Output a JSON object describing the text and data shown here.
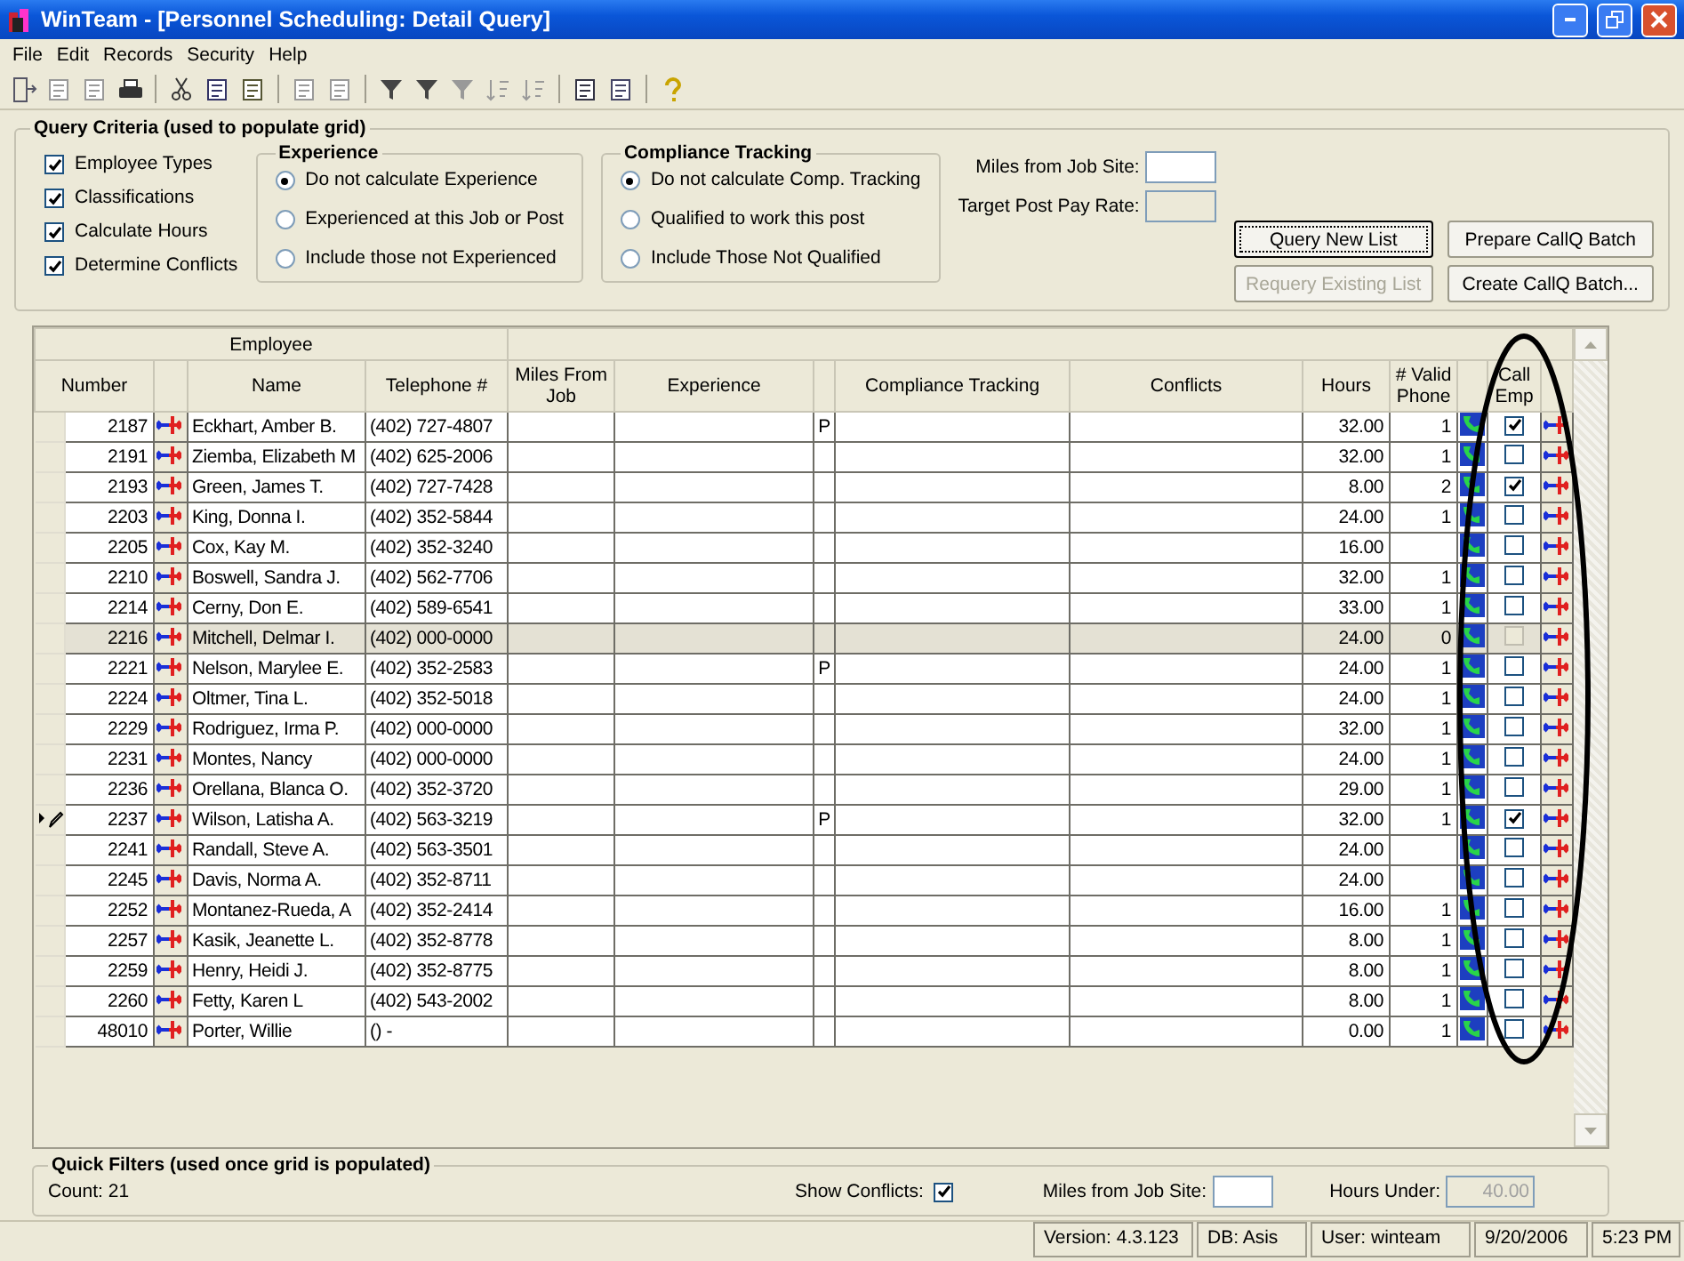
{
  "window": {
    "title": "WinTeam - [Personnel Scheduling:  Detail Query]"
  },
  "menu": [
    "File",
    "Edit",
    "Records",
    "Security",
    "Help"
  ],
  "query_criteria": {
    "title": "Query Criteria (used to populate grid)",
    "options": [
      {
        "label": "Employee Types",
        "checked": true
      },
      {
        "label": "Classifications",
        "checked": true
      },
      {
        "label": "Calculate Hours",
        "checked": true
      },
      {
        "label": "Determine Conflicts",
        "checked": true
      }
    ],
    "groups": [
      {
        "title": "Experience",
        "choices": [
          {
            "label": "Do not calculate Experience",
            "selected": true
          },
          {
            "label": "Experienced at this Job or Post",
            "selected": false
          },
          {
            "label": "Include those not Experienced",
            "selected": false
          }
        ]
      },
      {
        "title": "Compliance Tracking",
        "choices": [
          {
            "label": "Do not calculate Comp. Tracking",
            "selected": true
          },
          {
            "label": "Qualified to work this post",
            "selected": false
          },
          {
            "label": "Include Those Not Qualified",
            "selected": false
          }
        ]
      }
    ],
    "fields": [
      {
        "label": "Miles from Job Site:",
        "disabled": false
      },
      {
        "label": "Target Post Pay Rate:",
        "disabled": true
      }
    ],
    "buttons": [
      {
        "label": "Query New List",
        "disabled": false,
        "focused": true
      },
      {
        "label": "Prepare CallQ Batch",
        "disabled": false,
        "focused": false
      },
      {
        "label": "Requery Existing List",
        "disabled": true,
        "focused": false
      },
      {
        "label": "Create CallQ Batch...",
        "disabled": false,
        "focused": false
      }
    ]
  },
  "grid": {
    "group_header": "Employee",
    "columns": [
      "Number",
      "Name",
      "Telephone #",
      "Miles From Job",
      "Experience",
      "Compliance Tracking",
      "Conflicts",
      "Hours",
      "# Valid Phone",
      "Call Emp"
    ],
    "rows": [
      {
        "number": "2187",
        "name": "Eckhart, Amber B.",
        "phone": "(402) 727-4807",
        "flag": "P",
        "hours": "32.00",
        "valid": "1",
        "call": true,
        "selected": false,
        "editing": false
      },
      {
        "number": "2191",
        "name": "Ziemba, Elizabeth M",
        "phone": "(402) 625-2006",
        "hours": "32.00",
        "valid": "1",
        "call": false,
        "selected": false,
        "editing": false
      },
      {
        "number": "2193",
        "name": "Green, James T.",
        "phone": "(402) 727-7428",
        "hours": "8.00",
        "valid": "2",
        "call": true,
        "selected": false,
        "editing": false
      },
      {
        "number": "2203",
        "name": "King, Donna I.",
        "phone": "(402) 352-5844",
        "hours": "24.00",
        "valid": "1",
        "call": false,
        "selected": false,
        "editing": false
      },
      {
        "number": "2205",
        "name": "Cox, Kay  M.",
        "phone": "(402) 352-3240",
        "hours": "16.00",
        "call": false,
        "selected": false,
        "editing": false
      },
      {
        "number": "2210",
        "name": "Boswell, Sandra J.",
        "phone": "(402) 562-7706",
        "hours": "32.00",
        "valid": "1",
        "call": false,
        "selected": false,
        "editing": false
      },
      {
        "number": "2214",
        "name": "Cerny, Don E.",
        "phone": "(402) 589-6541",
        "hours": "33.00",
        "valid": "1",
        "call": false,
        "selected": false,
        "editing": false
      },
      {
        "number": "2216",
        "name": "Mitchell, Delmar I.",
        "phone": "(402) 000-0000",
        "hours": "24.00",
        "valid": "0",
        "call": false,
        "selected": true,
        "editing": false
      },
      {
        "number": "2221",
        "name": "Nelson, Marylee E.",
        "phone": "(402) 352-2583",
        "flag": "P",
        "hours": "24.00",
        "valid": "1",
        "call": false,
        "selected": false,
        "editing": false
      },
      {
        "number": "2224",
        "name": "Oltmer, Tina L.",
        "phone": "(402) 352-5018",
        "hours": "24.00",
        "valid": "1",
        "call": false,
        "selected": false,
        "editing": false
      },
      {
        "number": "2229",
        "name": "Rodriguez, Irma P.",
        "phone": "(402) 000-0000",
        "hours": "32.00",
        "valid": "1",
        "call": false,
        "selected": false,
        "editing": false
      },
      {
        "number": "2231",
        "name": "Montes, Nancy",
        "phone": "(402) 000-0000",
        "hours": "24.00",
        "valid": "1",
        "call": false,
        "selected": false,
        "editing": false
      },
      {
        "number": "2236",
        "name": "Orellana, Blanca O.",
        "phone": "(402) 352-3720",
        "hours": "29.00",
        "valid": "1",
        "call": false,
        "selected": false,
        "editing": false
      },
      {
        "number": "2237",
        "name": "Wilson, Latisha A.",
        "phone": "(402) 563-3219",
        "flag": "P",
        "hours": "32.00",
        "valid": "1",
        "call": true,
        "selected": false,
        "editing": true
      },
      {
        "number": "2241",
        "name": "Randall, Steve A.",
        "phone": "(402) 563-3501",
        "hours": "24.00",
        "call": false,
        "selected": false,
        "editing": false
      },
      {
        "number": "2245",
        "name": "Davis, Norma A.",
        "phone": "(402) 352-8711",
        "hours": "24.00",
        "call": false,
        "selected": false,
        "editing": false
      },
      {
        "number": "2252",
        "name": "Montanez-Rueda, A",
        "phone": "(402) 352-2414",
        "hours": "16.00",
        "valid": "1",
        "call": false,
        "selected": false,
        "editing": false
      },
      {
        "number": "2257",
        "name": "Kasik, Jeanette L.",
        "phone": "(402) 352-8778",
        "hours": "8.00",
        "valid": "1",
        "call": false,
        "selected": false,
        "editing": false
      },
      {
        "number": "2259",
        "name": "Henry, Heidi J.",
        "phone": "(402) 352-8775",
        "hours": "8.00",
        "valid": "1",
        "call": false,
        "selected": false,
        "editing": false
      },
      {
        "number": "2260",
        "name": "Fetty, Karen L",
        "phone": "(402) 543-2002",
        "hours": "8.00",
        "valid": "1",
        "call": false,
        "selected": false,
        "editing": false
      },
      {
        "number": "48010",
        "name": "Porter, Willie",
        "phone": "() -",
        "hours": "0.00",
        "valid": "1",
        "call": false,
        "selected": false,
        "editing": false
      }
    ]
  },
  "quick_filters": {
    "title": "Quick Filters (used once grid is populated)",
    "count": "Count: 21",
    "show_conflicts": {
      "label": "Show Conflicts:",
      "checked": true
    },
    "miles": {
      "label": "Miles from Job Site:"
    },
    "hours_under": {
      "label": "Hours Under:",
      "value": "40.00",
      "disabled": true
    }
  },
  "status_bar": [
    "Version: 4.3.123",
    "DB: Asis",
    "User: winteam",
    "9/20/2006",
    "5:23 PM"
  ]
}
